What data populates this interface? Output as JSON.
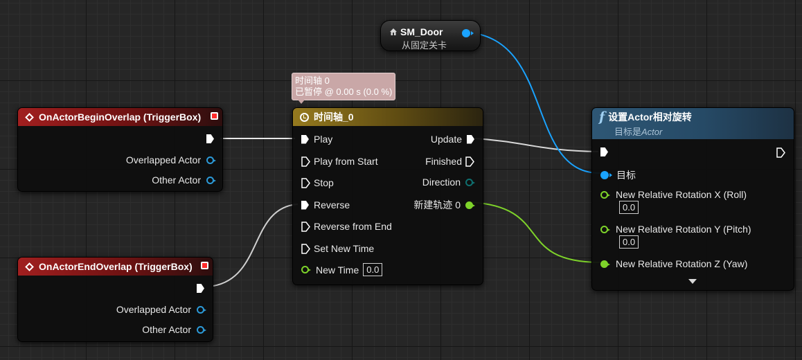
{
  "tooltip": {
    "line1": "时间轴 0",
    "line2": "已暂停 @ 0.00 s (0.0 %)"
  },
  "sm_door": {
    "title": "SM_Door",
    "subtitle": "从固定关卡"
  },
  "begin_overlap": {
    "title": "OnActorBeginOverlap (TriggerBox)",
    "pins": [
      "Overlapped Actor",
      "Other Actor"
    ]
  },
  "end_overlap": {
    "title": "OnActorEndOverlap (TriggerBox)",
    "pins": [
      "Overlapped Actor",
      "Other Actor"
    ]
  },
  "timeline": {
    "title": "时间轴_0",
    "inputs": [
      "Play",
      "Play from Start",
      "Stop",
      "Reverse",
      "Reverse from End",
      "Set New Time"
    ],
    "new_time_label": "New Time",
    "new_time_value": "0.0",
    "outputs": [
      "Update",
      "Finished",
      "Direction",
      "新建轨迹 0"
    ]
  },
  "set_rotation": {
    "title": "设置Actor相对旋转",
    "subtitle_prefix": "目标是",
    "subtitle_target": "Actor",
    "target_label": "目标",
    "pins": [
      {
        "label": "New Relative Rotation X (Roll)",
        "value": "0.0"
      },
      {
        "label": "New Relative Rotation Y (Pitch)",
        "value": "0.0"
      },
      {
        "label": "New Relative Rotation Z (Yaw)"
      }
    ]
  },
  "colors": {
    "exec_wire": "#e8e8e8",
    "object_wire": "#1aa3ff",
    "float_wire": "#7ed32a",
    "event_header": "#a11f1f",
    "timeline_header": "#967a1f",
    "function_header": "#2e5775"
  },
  "icons": [
    "event-diamond-icon",
    "close-pin-icon",
    "clock-icon",
    "function-icon",
    "house-icon",
    "expand-arrow-icon"
  ]
}
